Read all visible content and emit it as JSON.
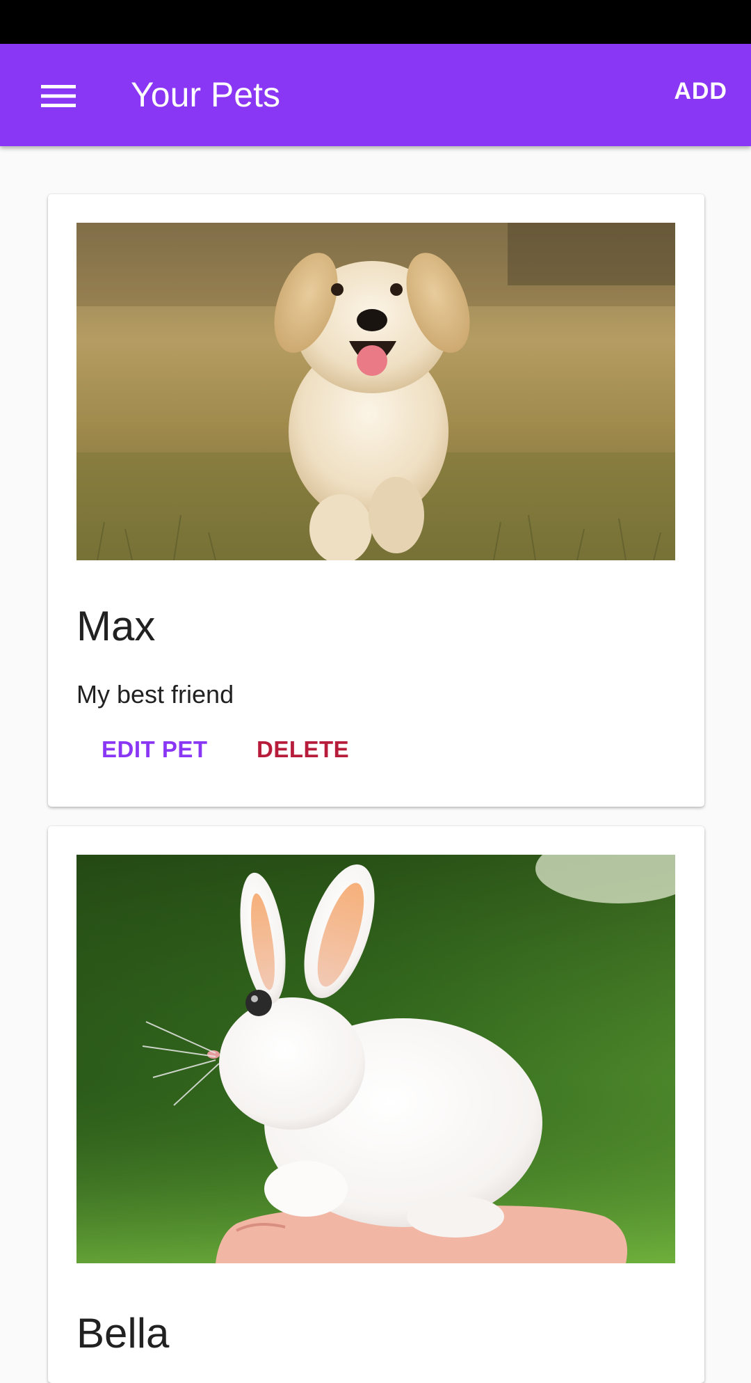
{
  "app_bar": {
    "title": "Your Pets",
    "menu_icon": "hamburger-menu-icon",
    "add_label": "ADD"
  },
  "colors": {
    "primary": "#8a37f5",
    "danger": "#b71c3a"
  },
  "pets": [
    {
      "name": "Max",
      "description": "My best friend",
      "image": "golden-retriever-puppy-photo",
      "edit_label": "EDIT PET",
      "delete_label": "DELETE"
    },
    {
      "name": "Bella",
      "image": "white-rabbit-photo"
    }
  ]
}
